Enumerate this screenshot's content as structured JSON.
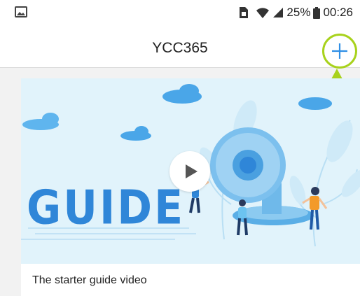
{
  "status_bar": {
    "battery_percent": "25%",
    "time": "00:26",
    "icons": [
      "gallery-icon",
      "sim-icon",
      "wifi-icon",
      "signal-icon",
      "battery-icon"
    ]
  },
  "header": {
    "title": "YCC365",
    "add_icon": "plus-icon",
    "accent_color": "#2f8fe6"
  },
  "annotation": {
    "highlight_color": "#a8d21c"
  },
  "video_card": {
    "thumbnail_text": "GUIDE",
    "play_icon": "play-icon",
    "caption": "The starter guide video"
  }
}
